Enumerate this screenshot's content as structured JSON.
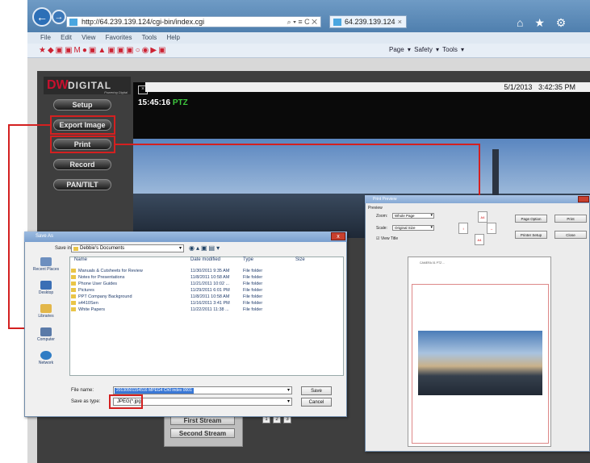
{
  "browser": {
    "address": "http://64.239.139.124/cgi-bin/index.cgi",
    "address_tools": "⌕ ▾ ≡ C ✕",
    "tab_title": "64.239.139.124",
    "tab_close": "×",
    "right_icons": "⌂ ★ ⚙",
    "menu": [
      "File",
      "Edit",
      "View",
      "Favorites",
      "Tools",
      "Help"
    ],
    "command_bar": "Page ▾  Safety ▾  Tools ▾"
  },
  "app": {
    "logo_dw": "DW",
    "logo_rest": "DIGITAL",
    "logo_tag": "Powering Digital",
    "buttons": {
      "setup": "Setup",
      "export": "Export Image",
      "print": "Print",
      "record": "Record",
      "pantilt": "PAN/TILT"
    },
    "date": "5/1/2013",
    "time": "3:42:35 PM",
    "overlay_time": "15:45:16",
    "overlay_ptz": "PTZ",
    "streams": [
      "First Stream",
      "Second Stream"
    ],
    "channel_buttons": [
      "1",
      "2",
      "3"
    ]
  },
  "save_dialog": {
    "title": "Save As",
    "close": "x",
    "save_in_label": "Save in:",
    "save_in_value": "Debbie's Documents",
    "places": [
      "Recent Places",
      "Desktop",
      "Libraries",
      "Computer",
      "Network"
    ],
    "columns": [
      "Name",
      "Date modified",
      "Type",
      "Size"
    ],
    "files": [
      {
        "name": "Manuals & Cutsheets for Review",
        "date": "11/30/2011 9:35 AM",
        "type": "File folder"
      },
      {
        "name": "Notes for Presentations",
        "date": "11/8/2011 10:58 AM",
        "type": "File folder"
      },
      {
        "name": "Phone User Guides",
        "date": "11/21/2011 10:02 ...",
        "type": "File folder"
      },
      {
        "name": "Pictures",
        "date": "11/29/2011 6:01 PM",
        "type": "File folder"
      },
      {
        "name": "PPT Company Background",
        "date": "11/8/2011 10:58 AM",
        "type": "File folder"
      },
      {
        "name": "s4410Sen",
        "date": "11/16/2011 3:41 PM",
        "type": "File folder"
      },
      {
        "name": "White Papers",
        "date": "11/22/2011 11:38 ...",
        "type": "File folder"
      }
    ],
    "file_name_label": "File name:",
    "file_name_value": "20130501154516 MPEG4 Ch0 index 0001",
    "save_type_label": "Save as type:",
    "save_type_value": "JPEG(*.jpg)",
    "save_btn": "Save",
    "cancel_btn": "Cancel"
  },
  "print_preview": {
    "title": "Print Preview",
    "group_label": "Preview",
    "zoom_label": "Zoom:",
    "zoom_value": "Whole Page",
    "scale_label": "Scale:",
    "scale_value": "Original Size",
    "view_title_label": "View Title",
    "btn_page_option": "Page Option",
    "btn_print": "Print",
    "btn_printer_setup": "Printer Setup",
    "btn_close": "Close",
    "paper_caption": "CAMERA 01   PTZ ..."
  }
}
